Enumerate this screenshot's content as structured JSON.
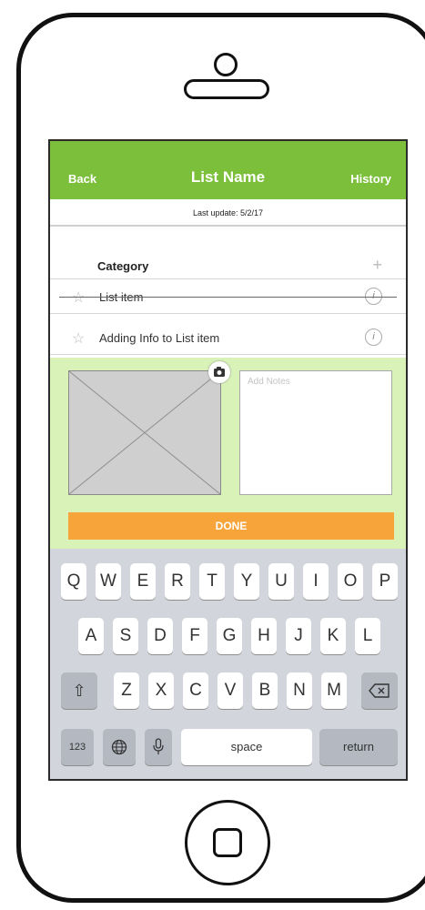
{
  "navbar": {
    "back_label": "Back",
    "title": "List Name",
    "history_label": "History",
    "color": "#7cbf3a"
  },
  "last_update": "Last update: 5/2/17",
  "category": {
    "label": "Category",
    "add_icon": "plus-icon"
  },
  "list_items": [
    {
      "label": "List item",
      "completed": true,
      "icon": "star-icon",
      "info_icon": "info-icon"
    },
    {
      "label": "Adding Info to List item",
      "completed": false,
      "icon": "star-icon",
      "info_icon": "info-icon"
    }
  ],
  "edit_panel": {
    "color": "#d8f2b8",
    "image_icon": "image-placeholder",
    "camera_icon": "camera-icon",
    "notes_placeholder": "Add Notes",
    "notes_value": "",
    "done_label": "DONE",
    "done_color": "#f7a43b"
  },
  "keyboard": {
    "row1": [
      "Q",
      "W",
      "E",
      "R",
      "T",
      "Y",
      "U",
      "I",
      "O",
      "P"
    ],
    "row2": [
      "A",
      "S",
      "D",
      "F",
      "G",
      "H",
      "J",
      "K",
      "L"
    ],
    "row3": [
      "Z",
      "X",
      "C",
      "V",
      "B",
      "N",
      "M"
    ],
    "numbers_label": "123",
    "space_label": "space",
    "return_label": "return",
    "shift_icon": "shift-icon",
    "backspace_icon": "backspace-icon",
    "globe_icon": "globe-icon",
    "mic_icon": "microphone-icon"
  }
}
